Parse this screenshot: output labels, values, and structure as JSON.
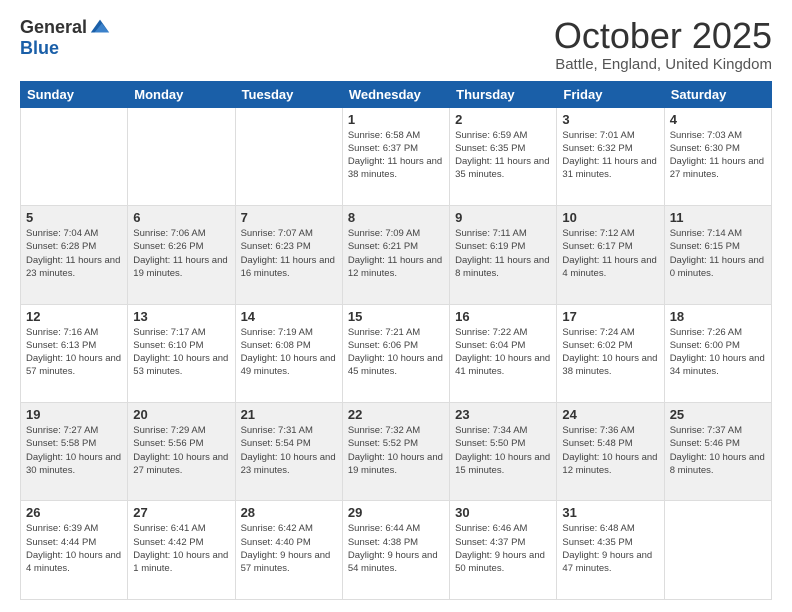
{
  "logo": {
    "general": "General",
    "blue": "Blue"
  },
  "title": "October 2025",
  "location": "Battle, England, United Kingdom",
  "weekdays": [
    "Sunday",
    "Monday",
    "Tuesday",
    "Wednesday",
    "Thursday",
    "Friday",
    "Saturday"
  ],
  "weeks": [
    [
      {
        "day": "",
        "sunrise": "",
        "sunset": "",
        "daylight": ""
      },
      {
        "day": "",
        "sunrise": "",
        "sunset": "",
        "daylight": ""
      },
      {
        "day": "",
        "sunrise": "",
        "sunset": "",
        "daylight": ""
      },
      {
        "day": "1",
        "sunrise": "6:58 AM",
        "sunset": "6:37 PM",
        "daylight": "11 hours and 38 minutes."
      },
      {
        "day": "2",
        "sunrise": "6:59 AM",
        "sunset": "6:35 PM",
        "daylight": "11 hours and 35 minutes."
      },
      {
        "day": "3",
        "sunrise": "7:01 AM",
        "sunset": "6:32 PM",
        "daylight": "11 hours and 31 minutes."
      },
      {
        "day": "4",
        "sunrise": "7:03 AM",
        "sunset": "6:30 PM",
        "daylight": "11 hours and 27 minutes."
      }
    ],
    [
      {
        "day": "5",
        "sunrise": "7:04 AM",
        "sunset": "6:28 PM",
        "daylight": "11 hours and 23 minutes."
      },
      {
        "day": "6",
        "sunrise": "7:06 AM",
        "sunset": "6:26 PM",
        "daylight": "11 hours and 19 minutes."
      },
      {
        "day": "7",
        "sunrise": "7:07 AM",
        "sunset": "6:23 PM",
        "daylight": "11 hours and 16 minutes."
      },
      {
        "day": "8",
        "sunrise": "7:09 AM",
        "sunset": "6:21 PM",
        "daylight": "11 hours and 12 minutes."
      },
      {
        "day": "9",
        "sunrise": "7:11 AM",
        "sunset": "6:19 PM",
        "daylight": "11 hours and 8 minutes."
      },
      {
        "day": "10",
        "sunrise": "7:12 AM",
        "sunset": "6:17 PM",
        "daylight": "11 hours and 4 minutes."
      },
      {
        "day": "11",
        "sunrise": "7:14 AM",
        "sunset": "6:15 PM",
        "daylight": "11 hours and 0 minutes."
      }
    ],
    [
      {
        "day": "12",
        "sunrise": "7:16 AM",
        "sunset": "6:13 PM",
        "daylight": "10 hours and 57 minutes."
      },
      {
        "day": "13",
        "sunrise": "7:17 AM",
        "sunset": "6:10 PM",
        "daylight": "10 hours and 53 minutes."
      },
      {
        "day": "14",
        "sunrise": "7:19 AM",
        "sunset": "6:08 PM",
        "daylight": "10 hours and 49 minutes."
      },
      {
        "day": "15",
        "sunrise": "7:21 AM",
        "sunset": "6:06 PM",
        "daylight": "10 hours and 45 minutes."
      },
      {
        "day": "16",
        "sunrise": "7:22 AM",
        "sunset": "6:04 PM",
        "daylight": "10 hours and 41 minutes."
      },
      {
        "day": "17",
        "sunrise": "7:24 AM",
        "sunset": "6:02 PM",
        "daylight": "10 hours and 38 minutes."
      },
      {
        "day": "18",
        "sunrise": "7:26 AM",
        "sunset": "6:00 PM",
        "daylight": "10 hours and 34 minutes."
      }
    ],
    [
      {
        "day": "19",
        "sunrise": "7:27 AM",
        "sunset": "5:58 PM",
        "daylight": "10 hours and 30 minutes."
      },
      {
        "day": "20",
        "sunrise": "7:29 AM",
        "sunset": "5:56 PM",
        "daylight": "10 hours and 27 minutes."
      },
      {
        "day": "21",
        "sunrise": "7:31 AM",
        "sunset": "5:54 PM",
        "daylight": "10 hours and 23 minutes."
      },
      {
        "day": "22",
        "sunrise": "7:32 AM",
        "sunset": "5:52 PM",
        "daylight": "10 hours and 19 minutes."
      },
      {
        "day": "23",
        "sunrise": "7:34 AM",
        "sunset": "5:50 PM",
        "daylight": "10 hours and 15 minutes."
      },
      {
        "day": "24",
        "sunrise": "7:36 AM",
        "sunset": "5:48 PM",
        "daylight": "10 hours and 12 minutes."
      },
      {
        "day": "25",
        "sunrise": "7:37 AM",
        "sunset": "5:46 PM",
        "daylight": "10 hours and 8 minutes."
      }
    ],
    [
      {
        "day": "26",
        "sunrise": "6:39 AM",
        "sunset": "4:44 PM",
        "daylight": "10 hours and 4 minutes."
      },
      {
        "day": "27",
        "sunrise": "6:41 AM",
        "sunset": "4:42 PM",
        "daylight": "10 hours and 1 minute."
      },
      {
        "day": "28",
        "sunrise": "6:42 AM",
        "sunset": "4:40 PM",
        "daylight": "9 hours and 57 minutes."
      },
      {
        "day": "29",
        "sunrise": "6:44 AM",
        "sunset": "4:38 PM",
        "daylight": "9 hours and 54 minutes."
      },
      {
        "day": "30",
        "sunrise": "6:46 AM",
        "sunset": "4:37 PM",
        "daylight": "9 hours and 50 minutes."
      },
      {
        "day": "31",
        "sunrise": "6:48 AM",
        "sunset": "4:35 PM",
        "daylight": "9 hours and 47 minutes."
      },
      {
        "day": "",
        "sunrise": "",
        "sunset": "",
        "daylight": ""
      }
    ]
  ],
  "labels": {
    "sunrise": "Sunrise:",
    "sunset": "Sunset:",
    "daylight": "Daylight:"
  }
}
